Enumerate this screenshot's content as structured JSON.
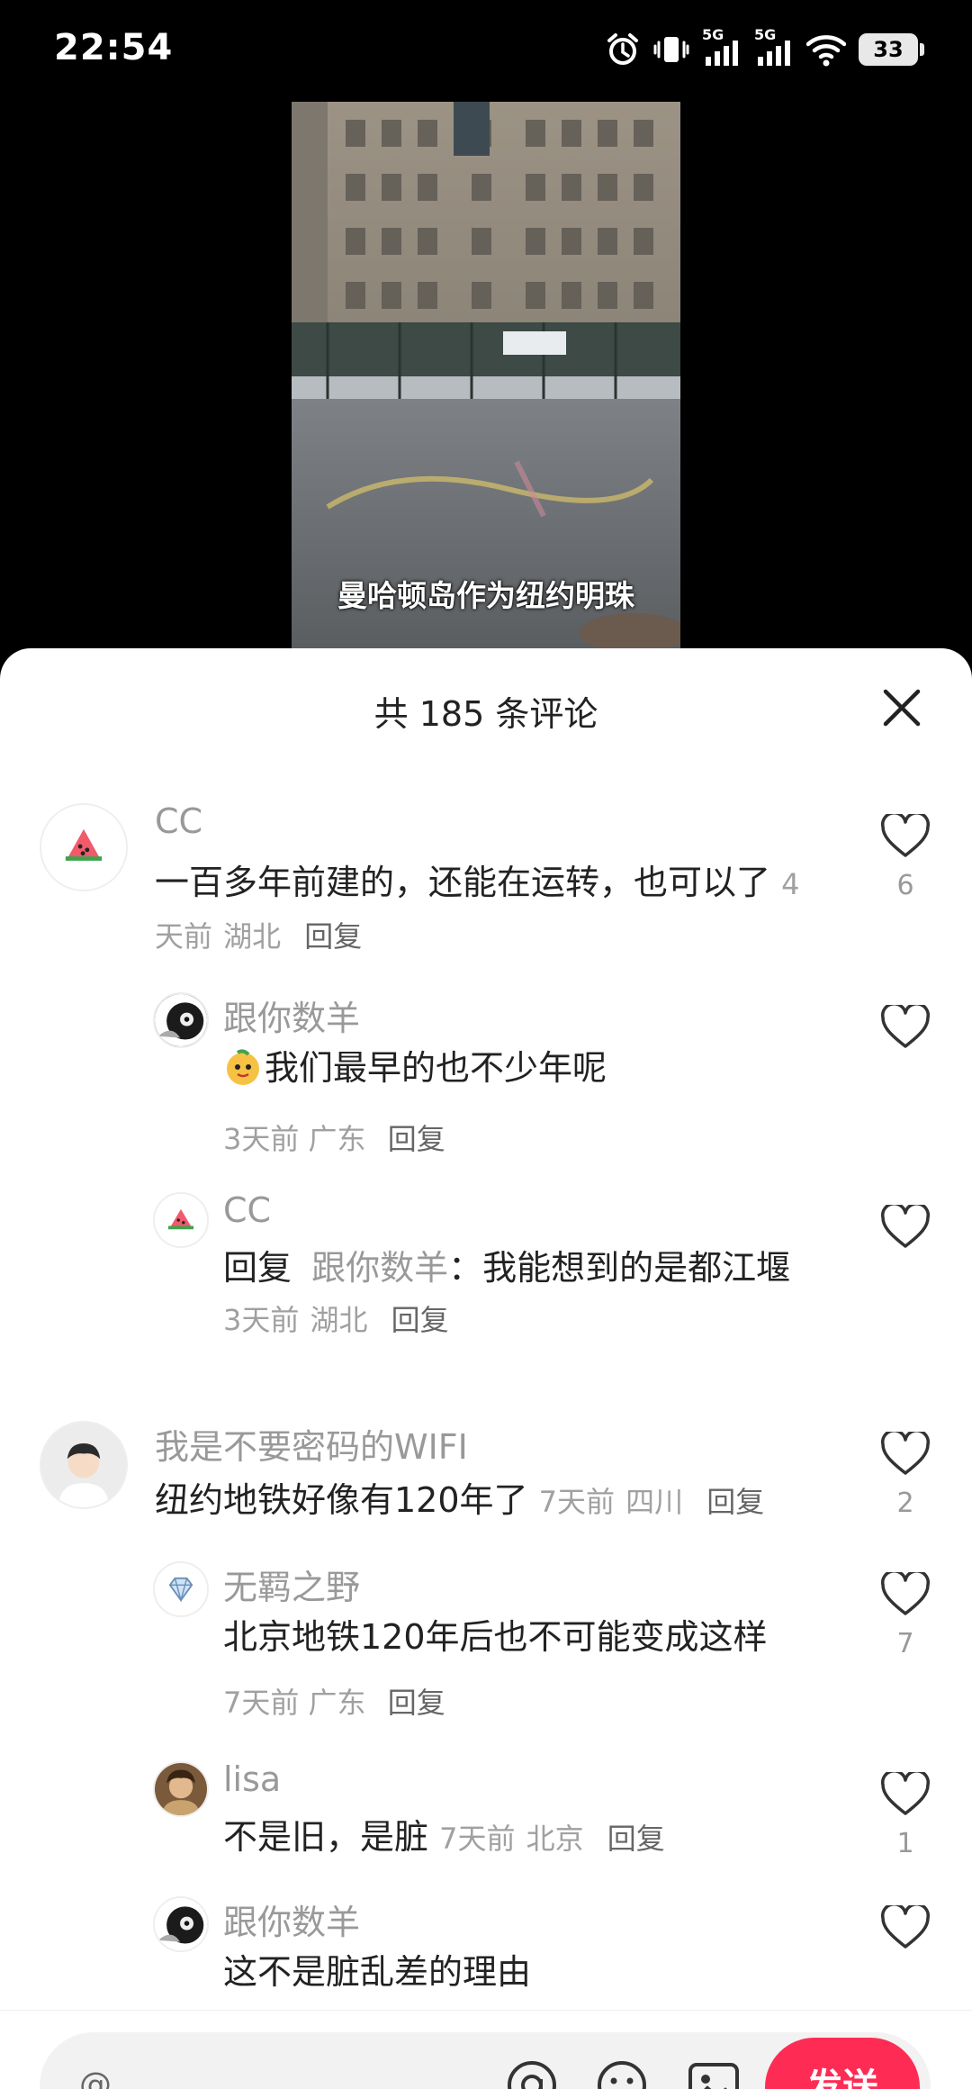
{
  "status_bar": {
    "time": "22:54",
    "battery": "33",
    "icons": [
      "alarm-icon",
      "vibrate-icon",
      "signal-5g-icon",
      "signal-5g-icon",
      "wifi-icon",
      "battery-icon"
    ],
    "network_label_1": "5G",
    "network_label_2": "5G"
  },
  "video": {
    "subtitle": "曼哈顿岛作为纽约明珠"
  },
  "comments_panel": {
    "title": "共 185 条评论",
    "close_icon": "close-icon",
    "comments": [
      {
        "user": "CC",
        "text": "一百多年前建的，还能在运转，也可以了",
        "time": "4天前",
        "location": "湖北",
        "reply": "回复",
        "likes": "6",
        "replies": [
          {
            "user": "跟你数羊",
            "text": "我们最早的也不少年呢",
            "time": "3天前",
            "location": "广东",
            "reply": "回复"
          },
          {
            "user": "CC",
            "reply_prefix": "回复",
            "reply_to": "跟你数羊",
            "text": "：我能想到的是都江堰",
            "time": "3天前",
            "location": "湖北",
            "reply": "回复"
          }
        ]
      },
      {
        "user": "我是不要密码的WIFI",
        "text": "纽约地铁好像有120年了",
        "time": "7天前",
        "location": "四川",
        "reply": "回复",
        "likes": "2",
        "replies": [
          {
            "user": "无羁之野",
            "text": "北京地铁120年后也不可能变成这样",
            "time": "7天前",
            "location": "广东",
            "reply": "回复",
            "likes": "7"
          },
          {
            "user": "lisa",
            "text": "不是旧，是脏",
            "time": "7天前",
            "location": "北京",
            "reply": "回复",
            "likes": "1"
          },
          {
            "user": "跟你数羊",
            "text": "这不是脏乱差的理由"
          }
        ]
      }
    ]
  },
  "input_bar": {
    "placeholder": "@",
    "icons": [
      "at-icon",
      "emoji-icon",
      "image-icon"
    ],
    "send_label": "发送"
  },
  "colors": {
    "accent": "#fe2c55",
    "text_primary": "#222222",
    "text_secondary": "#999999"
  }
}
